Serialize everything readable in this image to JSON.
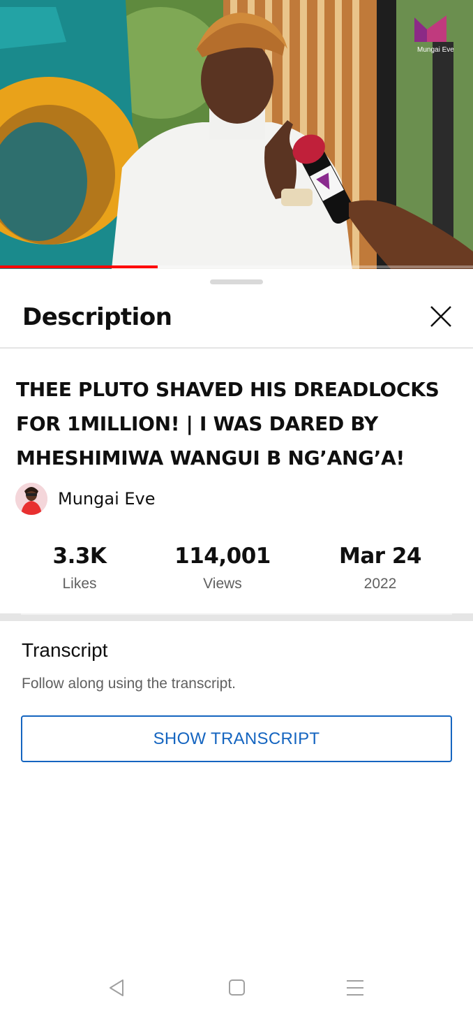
{
  "player": {
    "progress_fraction": 0.333,
    "watermark": "Mungai Eve",
    "accent_color": "#ff0000"
  },
  "sheet": {
    "title": "Description",
    "close_icon": "close-icon"
  },
  "video": {
    "title": "THEE PLUTO SHAVED HIS DREADLOCKS FOR 1MILLION! | I WAS DARED BY MHESHIMIWA WANGUI B NG’ANG’A!",
    "channel": "Mungai Eve"
  },
  "stats": [
    {
      "value": "3.3K",
      "label": "Likes"
    },
    {
      "value": "114,001",
      "label": "Views"
    },
    {
      "value": "Mar 24",
      "label": "2022"
    }
  ],
  "transcript": {
    "title": "Transcript",
    "subtitle": "Follow along using the transcript.",
    "button_label": "SHOW TRANSCRIPT",
    "button_color": "#1565c0"
  },
  "navbar": {
    "icons": [
      "back-icon",
      "home-icon",
      "recents-icon"
    ]
  }
}
